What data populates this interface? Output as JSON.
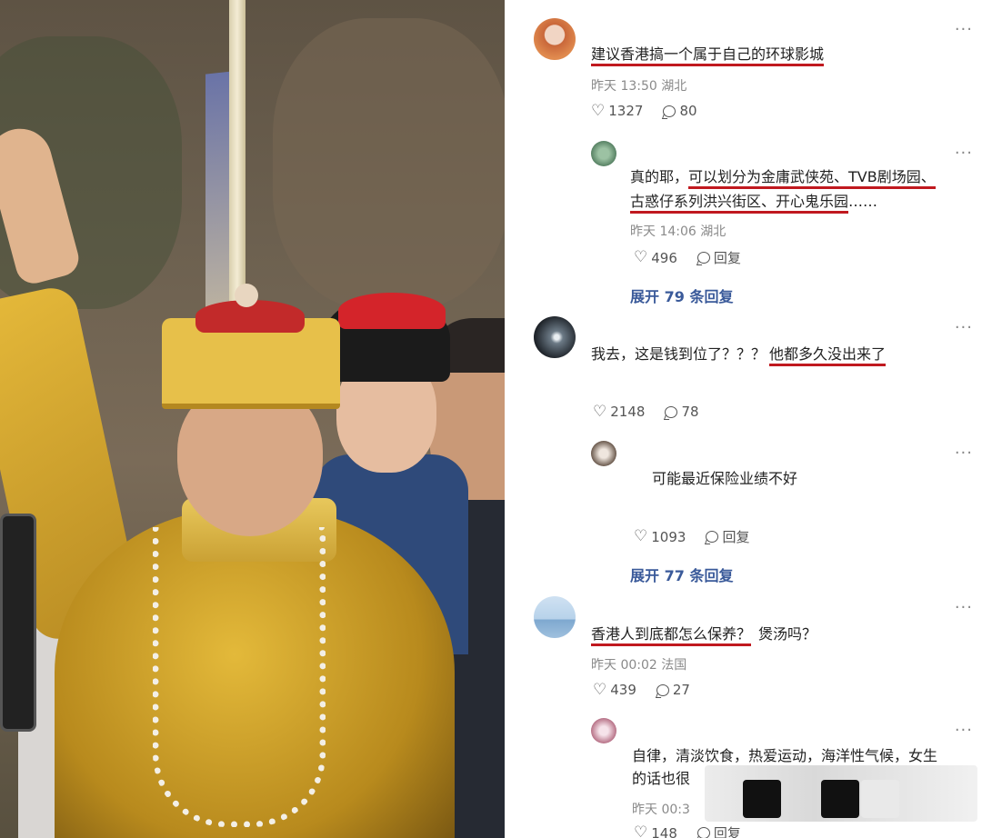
{
  "comments": [
    {
      "text": "建议香港搞一个属于自己的环球影城",
      "time": "昨天 13:50",
      "location": "湖北",
      "likes": "1327",
      "replies_count": "80",
      "reply": {
        "text_line1_prefix": "真的耶，",
        "text_line1_underlined": "可以划分为金庸武侠苑、TVB剧场园、",
        "text_line2_underlined": "古惑仔系列洪兴街区、开心鬼乐园",
        "text_line2_suffix": "……",
        "time": "昨天 14:06",
        "location": "湖北",
        "likes": "496",
        "reply_label": "回复",
        "expand_prefix": "展开",
        "expand_count": "79",
        "expand_suffix": "条回复"
      }
    },
    {
      "text_plain": "我去，这是钱到位了？？？",
      "text_underlined": "他都多久没出来了",
      "likes": "2148",
      "replies_count": "78",
      "reply": {
        "text": "可能最近保险业绩不好",
        "likes": "1093",
        "reply_label": "回复",
        "expand_prefix": "展开",
        "expand_count": "77",
        "expand_suffix": "条回复"
      }
    },
    {
      "text_underlined": "香港人到底都怎么保养？",
      "text_plain": "煲汤吗？",
      "time": "昨天 00:02",
      "location": "法国",
      "likes": "439",
      "replies_count": "27",
      "reply": {
        "text_line1": "自律，清淡饮食，热爱运动，海洋性气候，女生",
        "text_line2": "的话也很",
        "time": "昨天 00:3",
        "likes": "148",
        "reply_label": "回复"
      }
    }
  ],
  "ui": {
    "more_glyph": "···",
    "heart_glyph": "♡"
  },
  "colors": {
    "underline": "#c0191f",
    "expand": "#3a5a9a"
  }
}
